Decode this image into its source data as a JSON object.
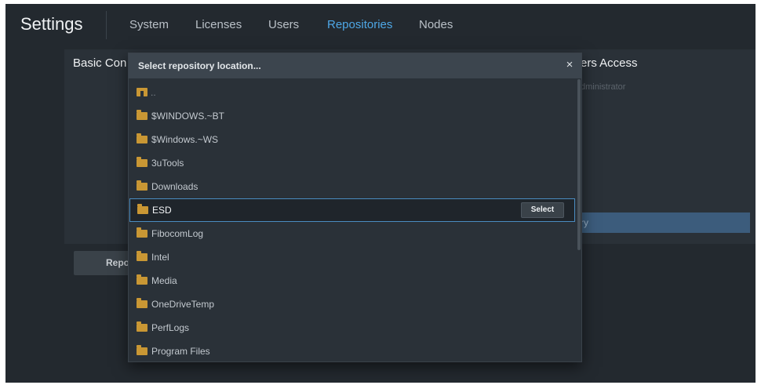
{
  "app": {
    "title": "Settings",
    "tabs": [
      {
        "label": "System",
        "active": false
      },
      {
        "label": "Licenses",
        "active": false
      },
      {
        "label": "Users",
        "active": false
      },
      {
        "label": "Repositories",
        "active": true
      },
      {
        "label": "Nodes",
        "active": false
      }
    ]
  },
  "background": {
    "left_heading": "Basic Con",
    "right_heading": "ers Access",
    "admin_text": "dministrator",
    "highlight_text": "ry",
    "button_label": "Repo"
  },
  "dialog": {
    "title": "Select repository location...",
    "close_icon": "close-icon",
    "parent_entry": "..",
    "items": [
      {
        "name": "$WINDOWS.~BT",
        "selected": false
      },
      {
        "name": "$Windows.~WS",
        "selected": false
      },
      {
        "name": "3uTools",
        "selected": false
      },
      {
        "name": "Downloads",
        "selected": false
      },
      {
        "name": "ESD",
        "selected": true
      },
      {
        "name": "FibocomLog",
        "selected": false
      },
      {
        "name": "Intel",
        "selected": false
      },
      {
        "name": "Media",
        "selected": false
      },
      {
        "name": "OneDriveTemp",
        "selected": false
      },
      {
        "name": "PerfLogs",
        "selected": false
      },
      {
        "name": "Program Files",
        "selected": false
      }
    ],
    "select_label": "Select"
  },
  "colors": {
    "background": "#23292f",
    "dialog": "#2a3138",
    "dialog_header": "#3c454e",
    "accent": "#4ea7e6",
    "folder": "#c99734",
    "selection_border": "#4a8cc0"
  }
}
